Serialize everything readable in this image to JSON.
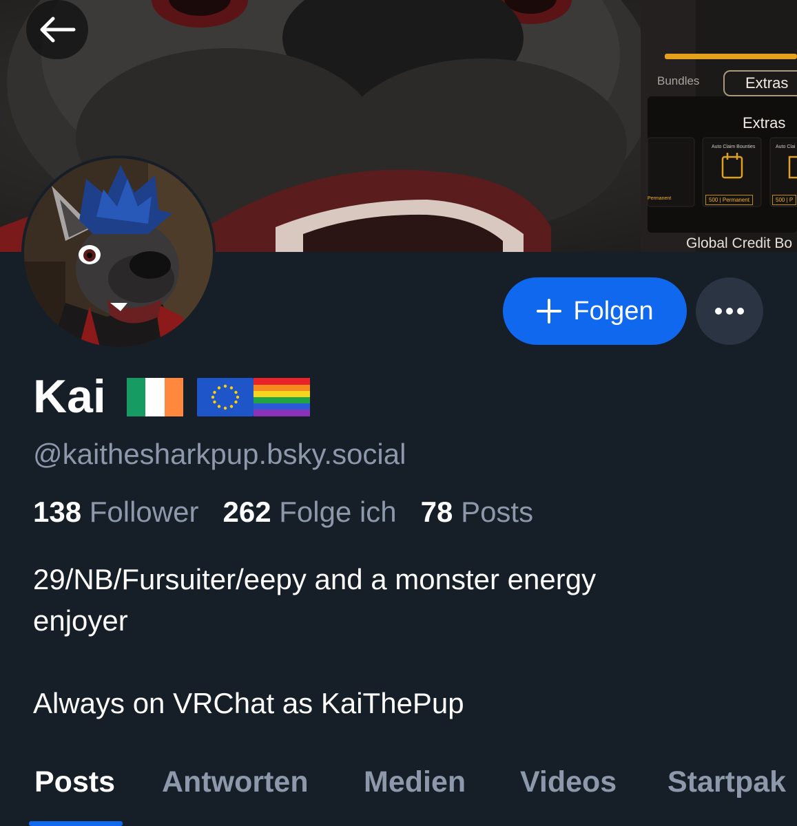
{
  "banner": {
    "overlay": {
      "tab_bundles": "Bundles",
      "tab_extras": "Extras",
      "section_title": "Extras",
      "card_1_label": "Auto Claim Bounties",
      "card_2_label": "Auto Clai",
      "card_0_price": "Permanent",
      "card_1_price": "500 | Permanent",
      "card_2_price": "500 | P",
      "footer": "Global Credit Bo"
    }
  },
  "header": {
    "back_icon": "arrow-left-icon"
  },
  "profile": {
    "display_name": "Kai",
    "flags": [
      "ireland-flag-icon",
      "eu-flag-icon",
      "rainbow-flag-icon"
    ],
    "handle": "@kaithesharkpup.bsky.social",
    "stats": {
      "followers_count": "138",
      "followers_label": "Follower",
      "following_count": "262",
      "following_label": "Folge ich",
      "posts_count": "78",
      "posts_label": "Posts"
    },
    "bio": {
      "line1": "29/NB/Fursuiter/eepy and a monster energy",
      "line2": "enjoyer",
      "line3": "Always on VRChat as KaiThePup"
    }
  },
  "actions": {
    "follow_label": "Folgen",
    "follow_icon": "plus-icon",
    "more_icon": "ellipsis-icon"
  },
  "tabs": {
    "items": [
      "Posts",
      "Antworten",
      "Medien",
      "Videos",
      "Startpak"
    ],
    "active": "Posts"
  },
  "colors": {
    "background": "#161e27",
    "accent": "#1068ef",
    "muted_text": "#8d99ab",
    "more_button": "#2a3443"
  }
}
